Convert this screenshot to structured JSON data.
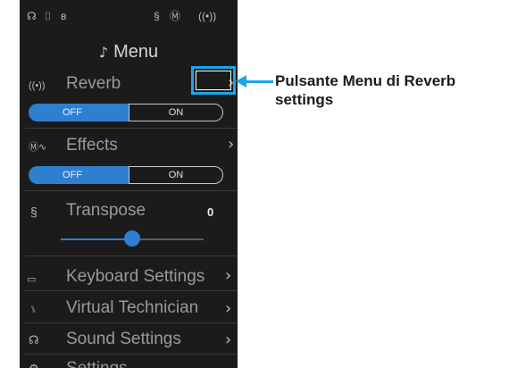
{
  "status_bar": {
    "icons": [
      "headphones-icon",
      "usb-icon",
      "bluetooth-icon",
      "transpose-icon",
      "effects-icon",
      "reverb-icon"
    ],
    "glyphs": [
      "☊",
      "⌷",
      "ʙ",
      "§",
      "Ⓜ",
      "((•))"
    ]
  },
  "menu": {
    "title": "Menu",
    "items": {
      "reverb": {
        "label": "Reverb",
        "toggle_off": "OFF",
        "toggle_on": "ON",
        "state": "OFF"
      },
      "effects": {
        "label": "Effects",
        "toggle_off": "OFF",
        "toggle_on": "ON",
        "state": "OFF"
      },
      "transpose": {
        "label": "Transpose",
        "value": "0",
        "slider_position": 0.5
      },
      "keyboard_settings": {
        "label": "Keyboard Settings"
      },
      "virtual_technician": {
        "label": "Virtual Technician"
      },
      "sound_settings": {
        "label": "Sound Settings"
      },
      "settings": {
        "label": "Settings"
      }
    },
    "chevron": "›"
  },
  "callout": {
    "text": "Pulsante Menu di Reverb settings"
  },
  "colors": {
    "accent": "#2f7fd0",
    "highlight": "#1aa6e8",
    "background": "#1b1b1b"
  }
}
